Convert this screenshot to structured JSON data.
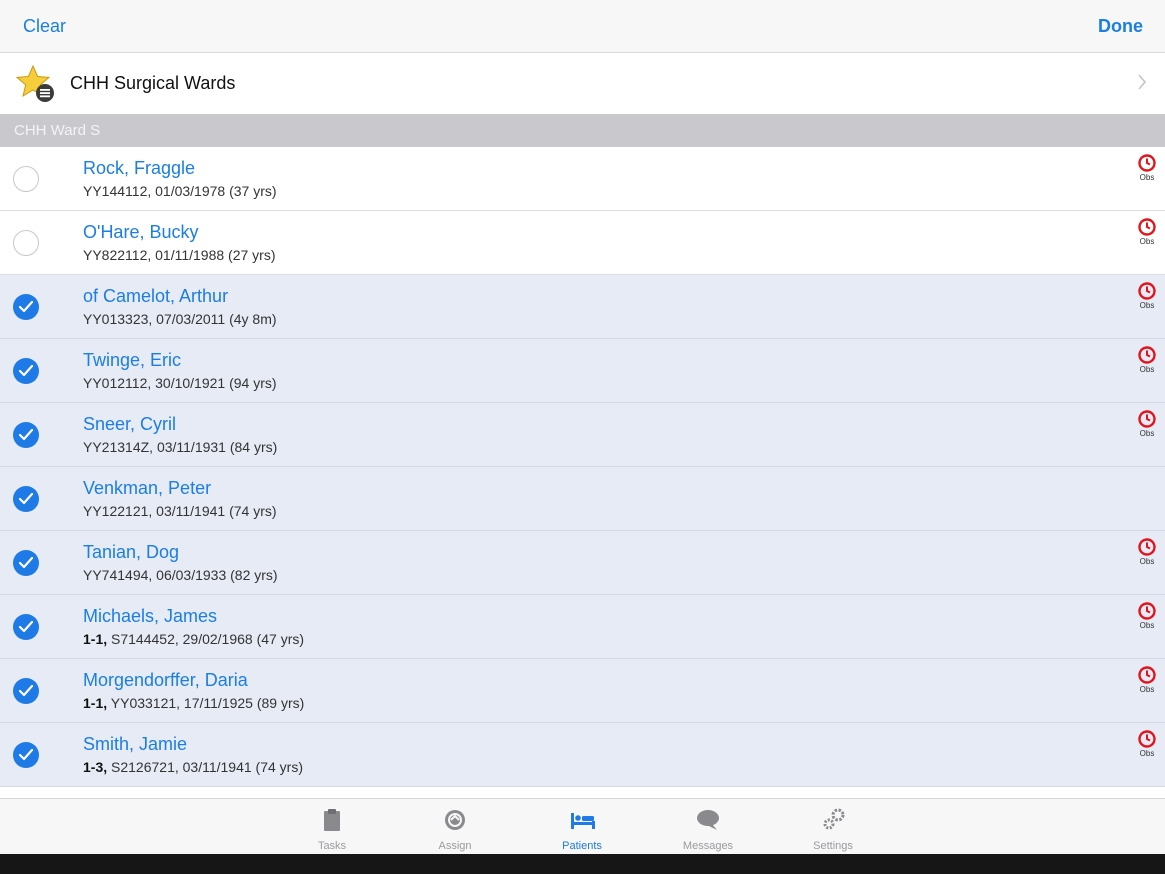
{
  "navbar": {
    "clear_label": "Clear",
    "done_label": "Done"
  },
  "ward": {
    "label": "CHH Surgical Wards"
  },
  "section": {
    "title": "CHH Ward S"
  },
  "obs_label": "Obs",
  "patients": [
    {
      "name": "Rock, Fraggle",
      "prefix": "",
      "detail": "YY144112, 01/03/1978 (37 yrs)",
      "selected": false,
      "obs": true
    },
    {
      "name": "O'Hare, Bucky",
      "prefix": "",
      "detail": "YY822112, 01/11/1988 (27 yrs)",
      "selected": false,
      "obs": true
    },
    {
      "name": "of Camelot, Arthur",
      "prefix": "",
      "detail": "YY013323, 07/03/2011 (4y 8m)",
      "selected": true,
      "obs": true
    },
    {
      "name": "Twinge, Eric",
      "prefix": "",
      "detail": "YY012112, 30/10/1921 (94 yrs)",
      "selected": true,
      "obs": true
    },
    {
      "name": "Sneer, Cyril",
      "prefix": "",
      "detail": "YY21314Z, 03/11/1931 (84 yrs)",
      "selected": true,
      "obs": true
    },
    {
      "name": "Venkman, Peter",
      "prefix": "",
      "detail": "YY122121, 03/11/1941 (74 yrs)",
      "selected": true,
      "obs": false
    },
    {
      "name": "Tanian, Dog",
      "prefix": "",
      "detail": "YY741494, 06/03/1933 (82 yrs)",
      "selected": true,
      "obs": true
    },
    {
      "name": "Michaels, James",
      "prefix": "1-1,",
      "detail": " S7144452, 29/02/1968 (47 yrs)",
      "selected": true,
      "obs": true
    },
    {
      "name": "Morgendorffer, Daria",
      "prefix": "1-1,",
      "detail": " YY033121, 17/11/1925 (89 yrs)",
      "selected": true,
      "obs": true
    },
    {
      "name": "Smith, Jamie",
      "prefix": "1-3,",
      "detail": " S2126721, 03/11/1941 (74 yrs)",
      "selected": true,
      "obs": true
    }
  ],
  "tabs": [
    {
      "label": "Tasks",
      "icon": "clipboard-icon",
      "active": false
    },
    {
      "label": "Assign",
      "icon": "assign-icon",
      "active": false
    },
    {
      "label": "Patients",
      "icon": "bed-icon",
      "active": true
    },
    {
      "label": "Messages",
      "icon": "speech-bubble-icon",
      "active": false
    },
    {
      "label": "Settings",
      "icon": "gears-icon",
      "active": false
    }
  ],
  "colors": {
    "accent": "#1a7ee3",
    "selected_row": "#e7ebf6",
    "obs_red": "#e3141b",
    "section_bg": "#c9c9cd"
  }
}
